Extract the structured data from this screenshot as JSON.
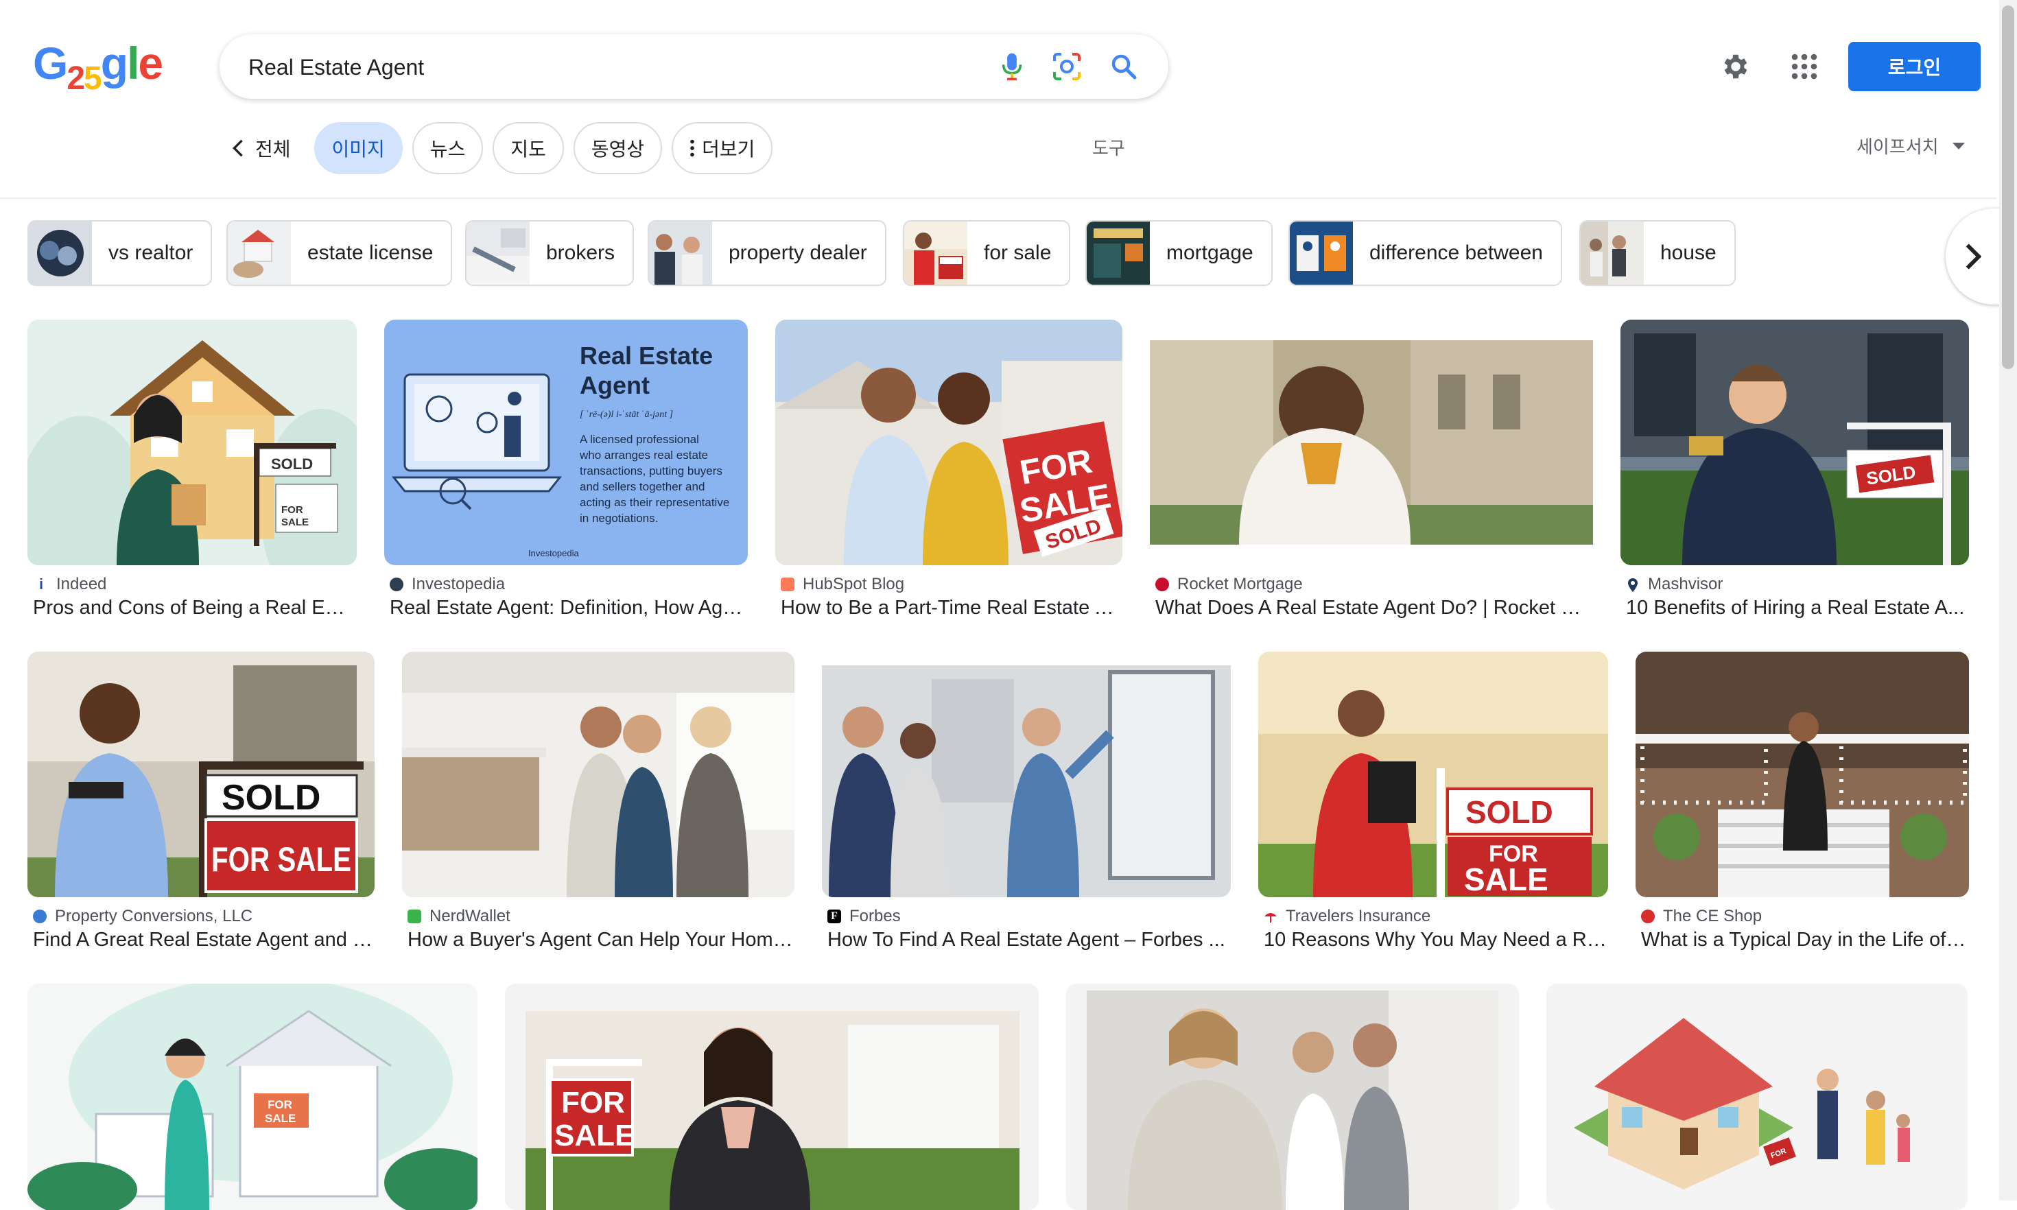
{
  "logo": {
    "letters": [
      "G",
      "2",
      "5",
      "g",
      "l",
      "e"
    ],
    "colors": [
      "#4285f4",
      "#ea4335",
      "#fbbc05",
      "#4285f4",
      "#34a853",
      "#ea4335"
    ]
  },
  "search": {
    "value": "Real Estate Agent",
    "placeholder": ""
  },
  "header": {
    "login_label": "로그인",
    "accent": "#1a73e8"
  },
  "tabs": {
    "back_label": "전체",
    "items": [
      {
        "label": "이미지",
        "active": true
      },
      {
        "label": "뉴스"
      },
      {
        "label": "지도"
      },
      {
        "label": "동영상"
      },
      {
        "label": "더보기"
      }
    ],
    "tools_label": "도구",
    "safesearch_label": "세이프서치"
  },
  "chips": [
    {
      "label": "vs realtor"
    },
    {
      "label": "estate license"
    },
    {
      "label": "brokers"
    },
    {
      "label": "property dealer"
    },
    {
      "label": "for sale"
    },
    {
      "label": "mortgage"
    },
    {
      "label": "difference between"
    },
    {
      "label": "house"
    }
  ],
  "results": [
    {
      "source": "Indeed",
      "title": "Pros and Cons of Being a Real Est...",
      "favicon_color": "#2557a7"
    },
    {
      "source": "Investopedia",
      "title": "Real Estate Agent: Definition, How Age...",
      "favicon_color": "#2c3e50",
      "image_text": {
        "heading1": "Real Estate",
        "heading2": "Agent",
        "pronunciation": "[ ˈrē-(ə)l i-ˈstāt ˈā-jənt ]",
        "definition": [
          "A licensed professional",
          "who arranges real estate",
          "transactions, putting buyers",
          "and sellers together and",
          "acting as their representative",
          "in negotiations."
        ],
        "brand": "Investopedia"
      }
    },
    {
      "source": "HubSpot Blog",
      "title": "How to Be a Part-Time Real Estate A...",
      "favicon_color": "#ff7a59"
    },
    {
      "source": "Rocket Mortgage",
      "title": "What Does A Real Estate Agent Do? | Rocket M...",
      "favicon_color": "#c8102e"
    },
    {
      "source": "Mashvisor",
      "title": "10 Benefits of Hiring a Real Estate A...",
      "favicon_color": "#1e3a5f"
    },
    {
      "source": "Property Conversions, LLC",
      "title": "Find A Great Real Estate Agent and F...",
      "favicon_color": "#3a7bd5"
    },
    {
      "source": "NerdWallet",
      "title": "How a Buyer's Agent Can Help Your Home...",
      "favicon_color": "#3ab54a"
    },
    {
      "source": "Forbes",
      "title": "How To Find A Real Estate Agent – Forbes ...",
      "favicon_color": "#000000"
    },
    {
      "source": "Travelers Insurance",
      "title": "10 Reasons Why You May Need a Re...",
      "favicon_color": "#e01933"
    },
    {
      "source": "The CE Shop",
      "title": "What is a Typical Day in the Life of ...",
      "favicon_color": "#d62d2d"
    }
  ],
  "image_signs": {
    "sold": "SOLD",
    "for": "FOR",
    "sale": "SALE",
    "for_sale": "FOR SALE"
  }
}
